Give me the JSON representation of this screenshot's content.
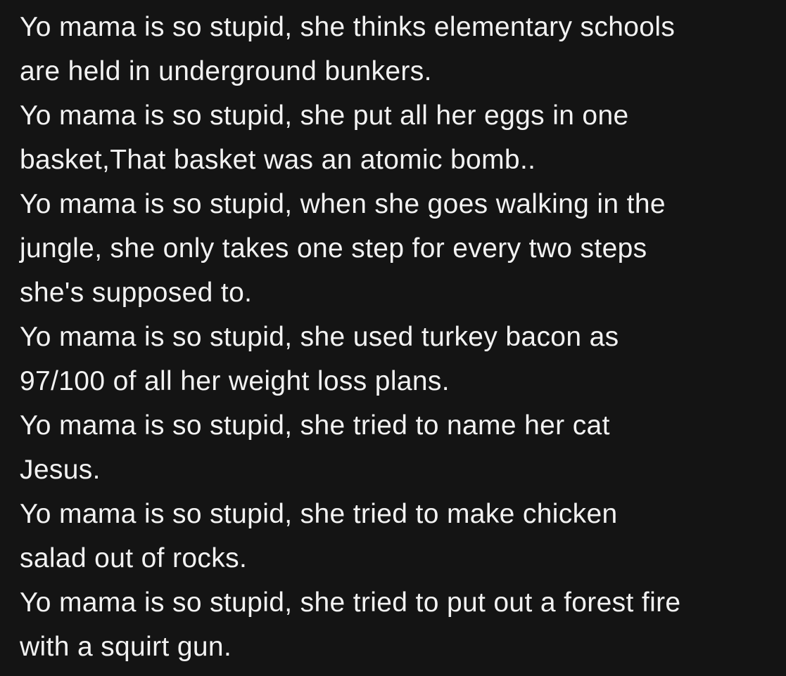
{
  "jokes": [
    "Yo mama is so stupid, she thinks elementary schools\nare held in underground bunkers.",
    "Yo mama is so stupid, she put all her eggs in one\nbasket,That basket was an atomic bomb..",
    "Yo mama is so stupid, when she goes walking in the\njungle, she only takes one step for every two steps\nshe's supposed to.",
    "Yo mama is so stupid, she used turkey bacon as\n97/100 of all her weight loss plans.",
    "Yo mama is so stupid, she tried to name her cat\nJesus.",
    "Yo mama is so stupid, she tried to make chicken\nsalad out of rocks.",
    "Yo mama is so stupid, she tried to put out a forest fire\nwith a squirt gun."
  ]
}
